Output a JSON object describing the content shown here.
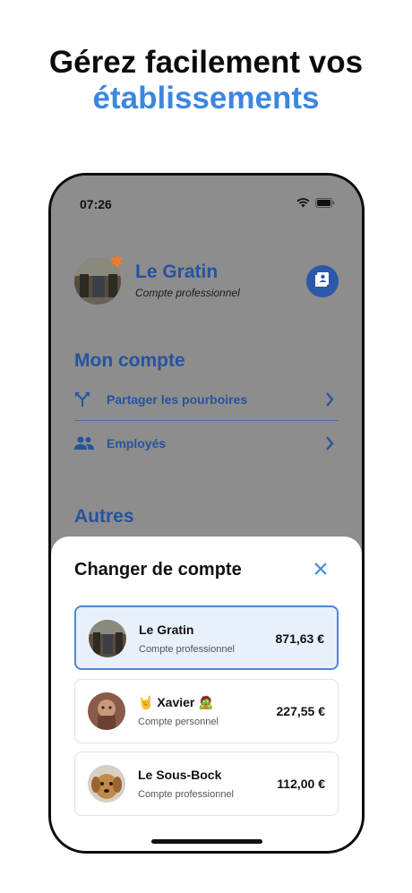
{
  "headline": {
    "line1": "Gérez facilement vos",
    "line2": "établissements"
  },
  "status": {
    "time": "07:26"
  },
  "profile": {
    "name": "Le Gratin",
    "subtitle": "Compte professionnel"
  },
  "sections": {
    "mon_compte": {
      "title": "Mon compte",
      "items": [
        {
          "label": "Partager les pourboires",
          "icon": "split-icon"
        },
        {
          "label": "Employés",
          "icon": "people-icon"
        }
      ]
    },
    "autres": {
      "title": "Autres"
    }
  },
  "sheet": {
    "title": "Changer de compte",
    "accounts": [
      {
        "name": "Le Gratin",
        "type": "Compte professionnel",
        "amount": "871,63 €",
        "selected": true
      },
      {
        "name": "🤘 Xavier 🧟",
        "type": "Compte personnel",
        "amount": "227,55 €",
        "selected": false
      },
      {
        "name": "Le Sous-Bock",
        "type": "Compte professionnel",
        "amount": "112,00 €",
        "selected": false
      }
    ]
  },
  "colors": {
    "accent": "#3d86e0",
    "brand_dark": "#2553a0",
    "selected_border": "#4f86d2",
    "selected_bg": "#e8f0fc"
  }
}
